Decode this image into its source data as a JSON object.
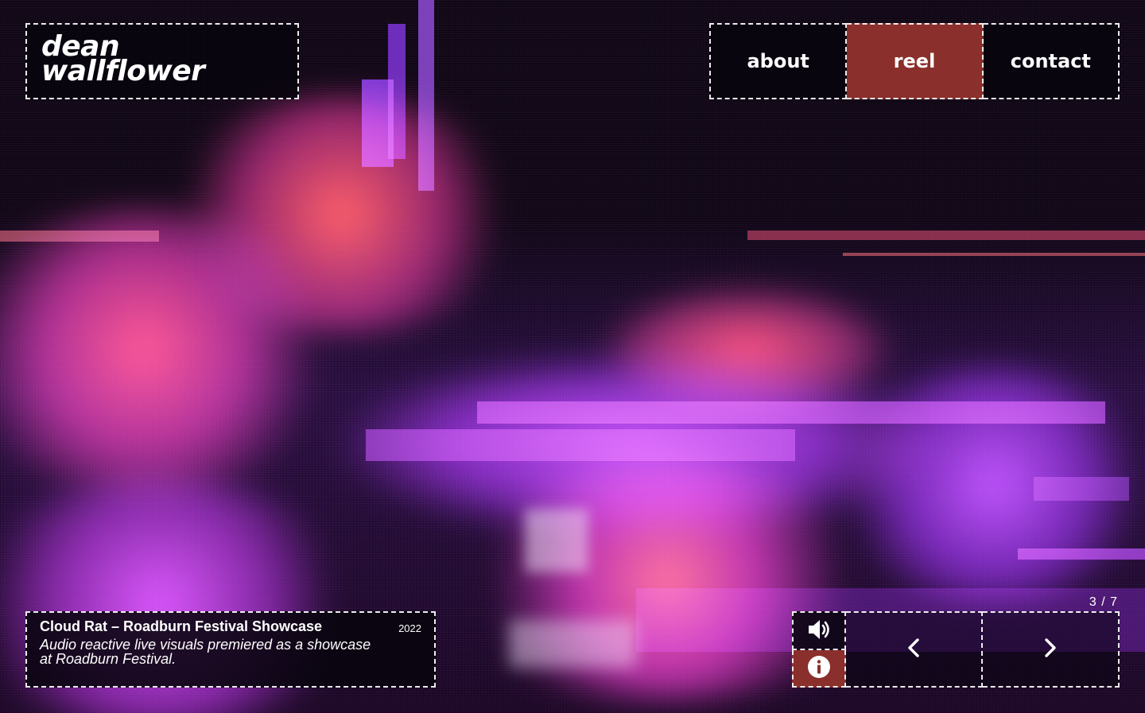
{
  "logo": {
    "line1": "dean",
    "line2": "wallflower"
  },
  "nav": {
    "items": [
      {
        "label": "about",
        "active": false
      },
      {
        "label": "reel",
        "active": true
      },
      {
        "label": "contact",
        "active": false
      }
    ]
  },
  "project": {
    "title": "Cloud Rat – Roadburn Festival Showcase",
    "year": "2022",
    "description": "Audio reactive live visuals premiered as a showcase at Roadburn Festival."
  },
  "pager": {
    "counter": "3 / 7"
  },
  "controls": {
    "sound_icon": "speaker-volume-icon",
    "info_icon": "info-circle-icon",
    "prev_icon": "chevron-left-icon",
    "next_icon": "chevron-right-icon"
  },
  "colors": {
    "accent": "#8a2f2c",
    "panel": "#08040e",
    "glitch_purple": "#9b3dff",
    "glitch_red": "#ff3b4f"
  }
}
